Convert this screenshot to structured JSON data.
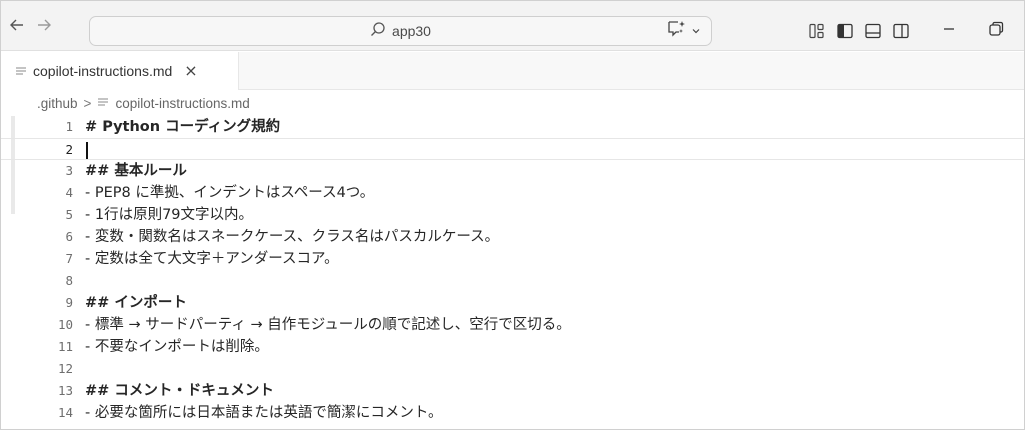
{
  "titlebar": {
    "search_label": "app30",
    "back_icon": "arrow-left-icon",
    "forward_icon": "arrow-right-icon"
  },
  "tabs": [
    {
      "label": "copilot-instructions.md",
      "close": "×"
    }
  ],
  "breadcrumb": {
    "folder": ".github",
    "separator": ">",
    "file": "copilot-instructions.md"
  },
  "editor": {
    "lines": [
      {
        "n": "1",
        "text": "# Python コーディング規約"
      },
      {
        "n": "2",
        "text": ""
      },
      {
        "n": "3",
        "text": "## 基本ルール"
      },
      {
        "n": "4",
        "text": "- PEP8 に準拠、インデントはスペース4つ。"
      },
      {
        "n": "5",
        "text": "- 1行は原則79文字以内。"
      },
      {
        "n": "6",
        "text": "- 変数・関数名はスネークケース、クラス名はパスカルケース。"
      },
      {
        "n": "7",
        "text": "- 定数は全て大文字＋アンダースコア。"
      },
      {
        "n": "8",
        "text": ""
      },
      {
        "n": "9",
        "text": "## インポート"
      },
      {
        "n": "10",
        "text": "- 標準 → サードパーティ → 自作モジュールの順で記述し、空行で区切る。"
      },
      {
        "n": "11",
        "text": "- 不要なインポートは削除。"
      },
      {
        "n": "12",
        "text": ""
      },
      {
        "n": "13",
        "text": "## コメント・ドキュメント"
      },
      {
        "n": "14",
        "text": "- 必要な箇所には日本語または英語で簡潔にコメント。"
      }
    ]
  },
  "colors": {
    "titlebar_bg": "#f3f3f3",
    "editor_bg": "#ffffff",
    "line_number": "#6e6e6e"
  }
}
